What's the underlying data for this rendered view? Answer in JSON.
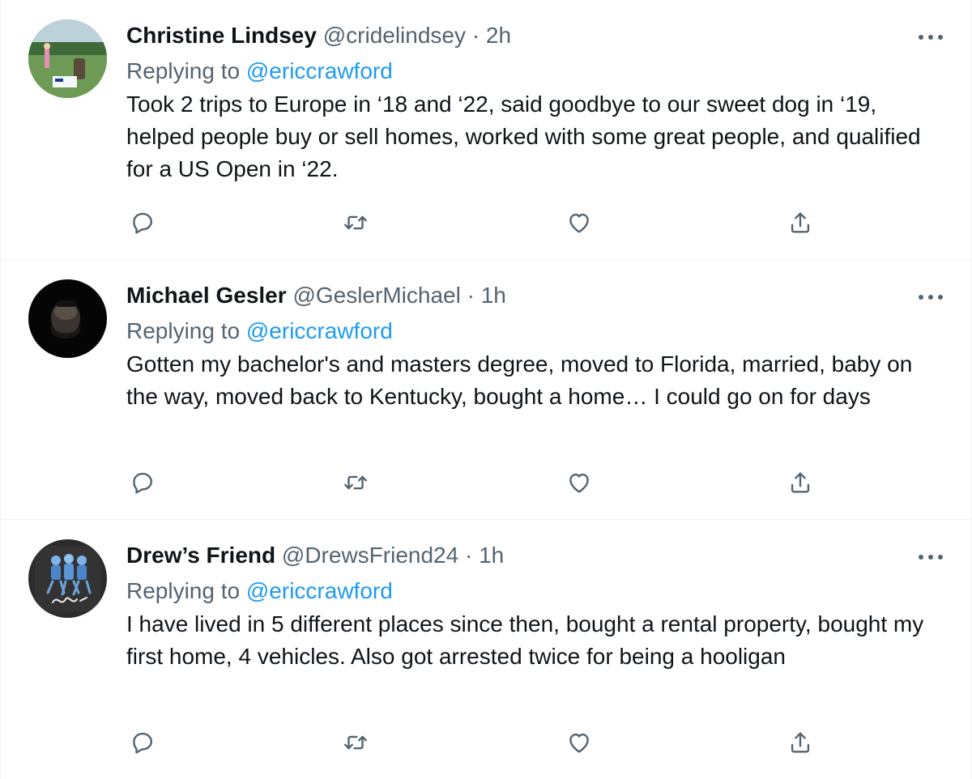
{
  "colors": {
    "accent": "#1d9bf0",
    "secondary_text": "#536471",
    "primary_text": "#0f1419",
    "divider": "#eff3f4"
  },
  "tweets": [
    {
      "display_name": "Christine Lindsey",
      "handle": "@cridelindsey",
      "separator": "·",
      "time": "2h",
      "replying_prefix": "Replying to",
      "replying_to": "@ericcrawford",
      "text": "Took 2 trips to Europe in ‘18 and ‘22, said goodbye to our sweet dog in ‘19, helped people buy or sell homes, worked with some great people, and qualified for a US Open in ‘22.",
      "avatar": "golf-course-photo"
    },
    {
      "display_name": "Michael Gesler",
      "handle": "@GeslerMichael",
      "separator": "·",
      "time": "1h",
      "replying_prefix": "Replying to",
      "replying_to": "@ericcrawford",
      "text": "Gotten my bachelor's and masters degree, moved to Florida,  married, baby on the way, moved back to Kentucky, bought a home… I could go on for days",
      "avatar": "dark-portrait-photo"
    },
    {
      "display_name": "Drew’s Friend",
      "handle": "@DrewsFriend24",
      "separator": "·",
      "time": "1h",
      "replying_prefix": "Replying to",
      "replying_to": "@ericcrawford",
      "text": "I have lived in 5 different places since then, bought a rental property, bought my first home, 4 vehicles. Also got arrested twice for being a hooligan",
      "avatar": "signed-football-art-photo"
    }
  ],
  "icons": {
    "more": "more-horizontal-icon",
    "reply": "reply-bubble-icon",
    "retweet": "retweet-icon",
    "like": "heart-icon",
    "share": "share-upload-icon"
  }
}
